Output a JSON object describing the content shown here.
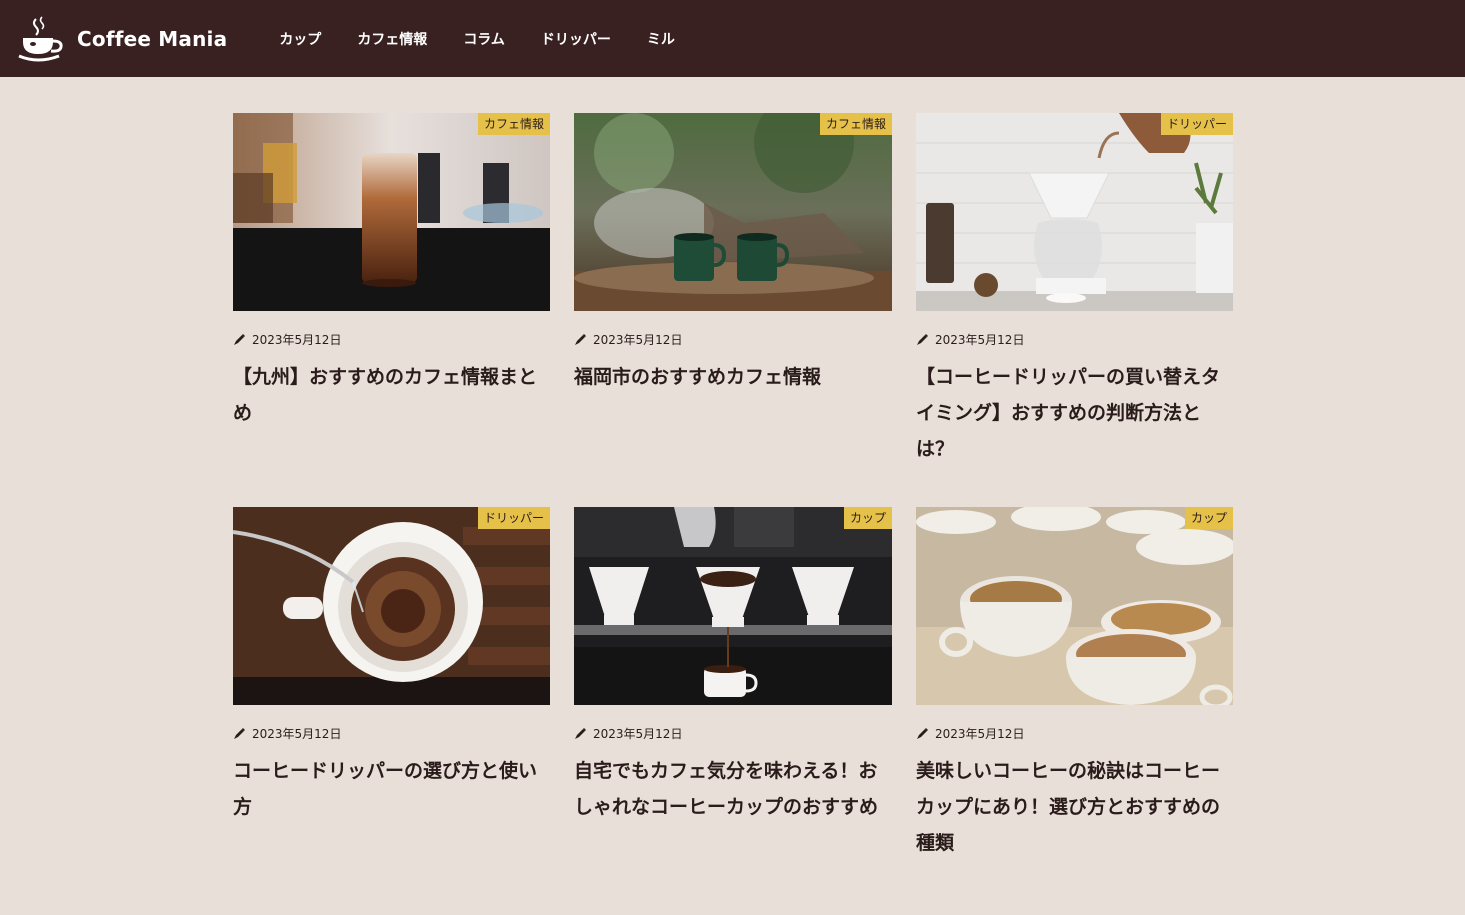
{
  "site": {
    "name": "Coffee Mania",
    "logo_icon": "coffee-cup-logo"
  },
  "nav": [
    {
      "label": "カップ"
    },
    {
      "label": "カフェ情報"
    },
    {
      "label": "コラム"
    },
    {
      "label": "ドリッパー"
    },
    {
      "label": "ミル"
    }
  ],
  "colors": {
    "header_bg": "#382120",
    "page_bg": "#e8dfd9",
    "tag_bg": "#e5c14a",
    "text": "#2a1c1a"
  },
  "articles": [
    {
      "category": "カフェ情報",
      "date": "2023年5月12日",
      "title": "【九州】おすすめのカフェ情報まとめ",
      "image": "iced-coffee-glass"
    },
    {
      "category": "カフェ情報",
      "date": "2023年5月12日",
      "title": "福岡市のおすすめカフェ情報",
      "image": "green-mugs-campfire"
    },
    {
      "category": "ドリッパー",
      "date": "2023年5月12日",
      "title": "【コーヒードリッパーの買い替えタイミング】おすすめの判断方法とは？",
      "image": "pour-over-kettle"
    },
    {
      "category": "ドリッパー",
      "date": "2023年5月12日",
      "title": "コーヒードリッパーの選び方と使い方",
      "image": "filter-dripper-closeup"
    },
    {
      "category": "カップ",
      "date": "2023年5月12日",
      "title": "自宅でもカフェ気分を味わえる！おしゃれなコーヒーカップのおすすめ",
      "image": "three-drippers-cups"
    },
    {
      "category": "カップ",
      "date": "2023年5月12日",
      "title": "美味しいコーヒーの秘訣はコーヒーカップにあり！選び方とおすすめの種類",
      "image": "stacked-used-cups"
    }
  ]
}
